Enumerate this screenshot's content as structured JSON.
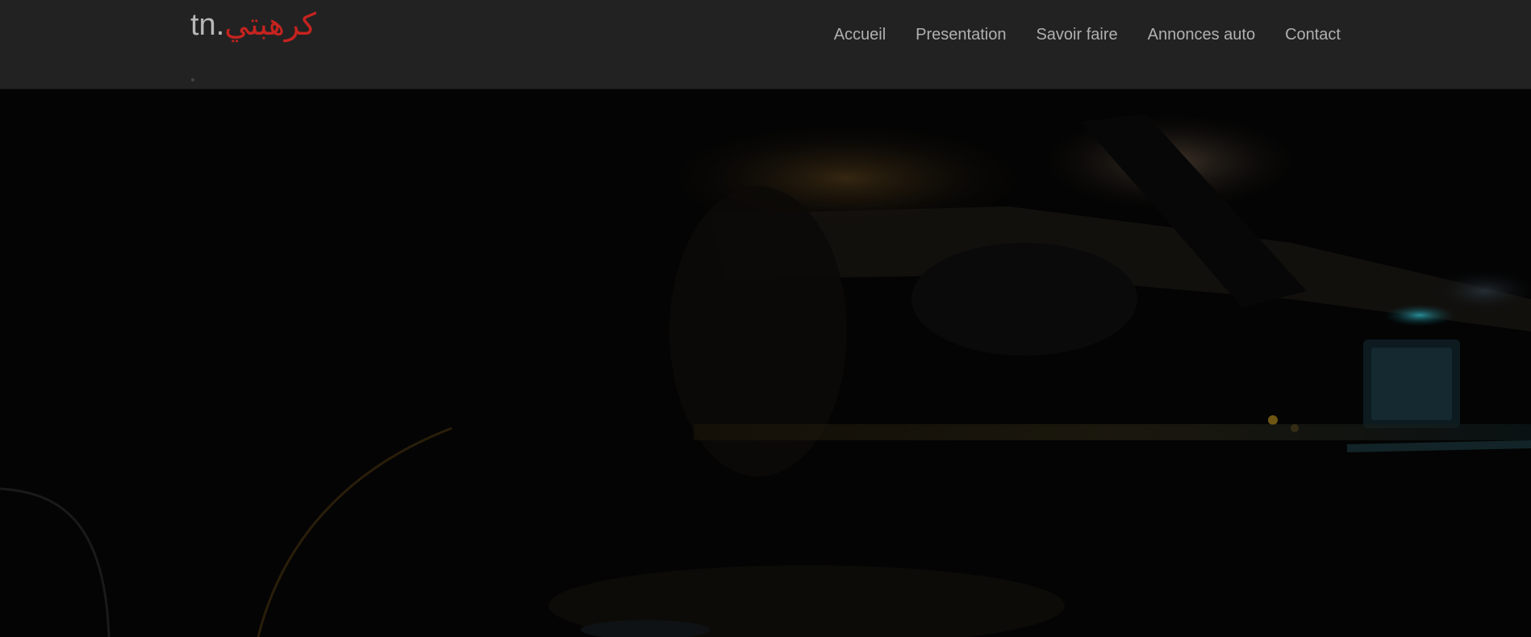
{
  "brand": {
    "prefix": "tn",
    "dot": ".",
    "arabic": "كرهبتي"
  },
  "nav": {
    "items": [
      {
        "label": "Accueil"
      },
      {
        "label": "Presentation"
      },
      {
        "label": "Savoir faire"
      },
      {
        "label": "Annonces auto"
      },
      {
        "label": "Contact"
      }
    ]
  },
  "colors": {
    "navbar_bg": "#222222",
    "nav_text": "#b0b0b0",
    "brand_accent": "#c6231f",
    "hero_bg": "#040404"
  }
}
